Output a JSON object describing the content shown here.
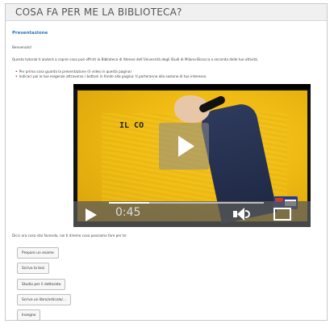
{
  "page": {
    "title": "COSA FA PER ME LA BIBLIOTECA?"
  },
  "content": {
    "section_title": "Presentazione",
    "greeting": "Benvenuto!",
    "intro": "Questo tutorial ti aiuterà a capire cosa può offrirti la Biblioteca di Ateneo dell'Università degli Studi di Milano-Bicocca a seconda delle tue attività.",
    "bullets": [
      "Per prima cosa guarda la presentazione (il video in questa pagina)",
      "Indicaci poi le tue esigenze attraverso i bottoni in fondo alla pagina: ti porteranno alla sezione di tuo interesse."
    ],
    "after_video": "Dicci ora cosa stai facendo, noi ti diremo cosa possiamo fare per te:"
  },
  "video": {
    "overlay_text": "IL CO",
    "current_time": "0:45",
    "progress": 0.26
  },
  "buttons": [
    {
      "label": "Preparo un esame"
    },
    {
      "label": "Scrivo la tesi"
    },
    {
      "label": "Studio per il dottorato"
    },
    {
      "label": "Scrivo un libro/articolo/..."
    },
    {
      "label": "Insegno"
    }
  ],
  "colors": {
    "section_title": "#2b76b7",
    "bullet": "#b22222"
  }
}
